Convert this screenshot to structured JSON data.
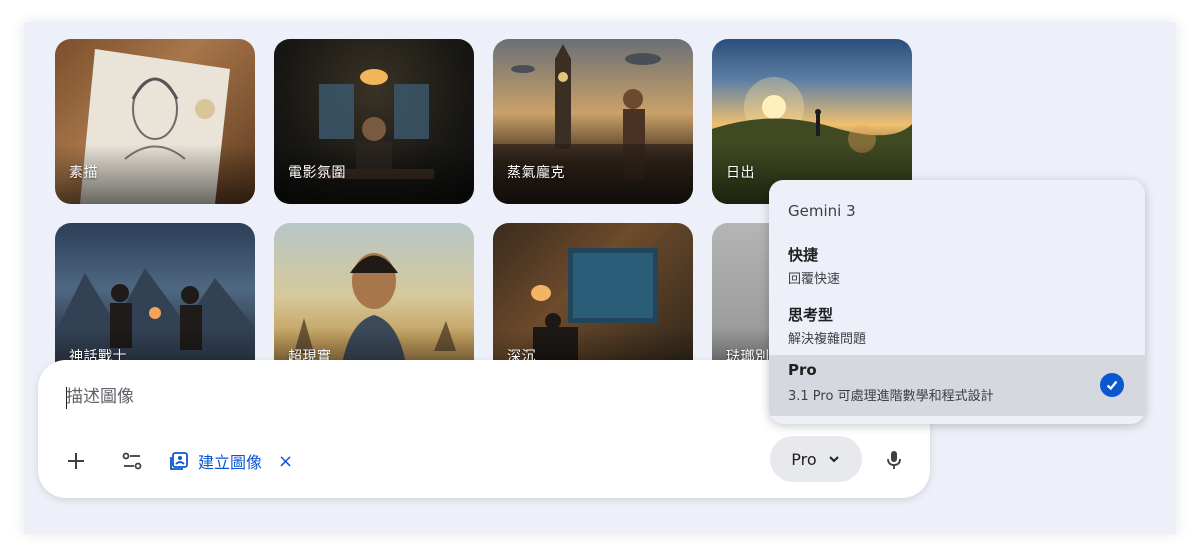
{
  "cards": [
    {
      "label": "素描"
    },
    {
      "label": "電影氛圍"
    },
    {
      "label": "蒸氣龐克"
    },
    {
      "label": "日出"
    },
    {
      "label": "神話戰士"
    },
    {
      "label": "超現實"
    },
    {
      "label": "深沉"
    },
    {
      "label": "琺瑯別"
    }
  ],
  "prompt": {
    "placeholder": "描述圖像",
    "chip_label": "建立圖像",
    "chip_close": "×",
    "model_label": "Pro",
    "icons": {
      "add": "plus-icon",
      "tools": "tools-icon",
      "chip": "image-create-icon",
      "dropdown": "chevron-down-icon",
      "mic": "mic-icon"
    }
  },
  "model_menu": {
    "header": "Gemini 3",
    "options": [
      {
        "title": "快捷",
        "subtitle": "回覆快速"
      },
      {
        "title": "思考型",
        "subtitle": "解決複雜問題"
      },
      {
        "title": "Pro",
        "subtitle": "3.1 Pro 可處理進階數學和程式設計",
        "selected": true
      }
    ]
  },
  "colors": {
    "accent": "#0b57d0",
    "panel_bg": "#edf0f8",
    "selected_bg": "#d5d8df"
  }
}
